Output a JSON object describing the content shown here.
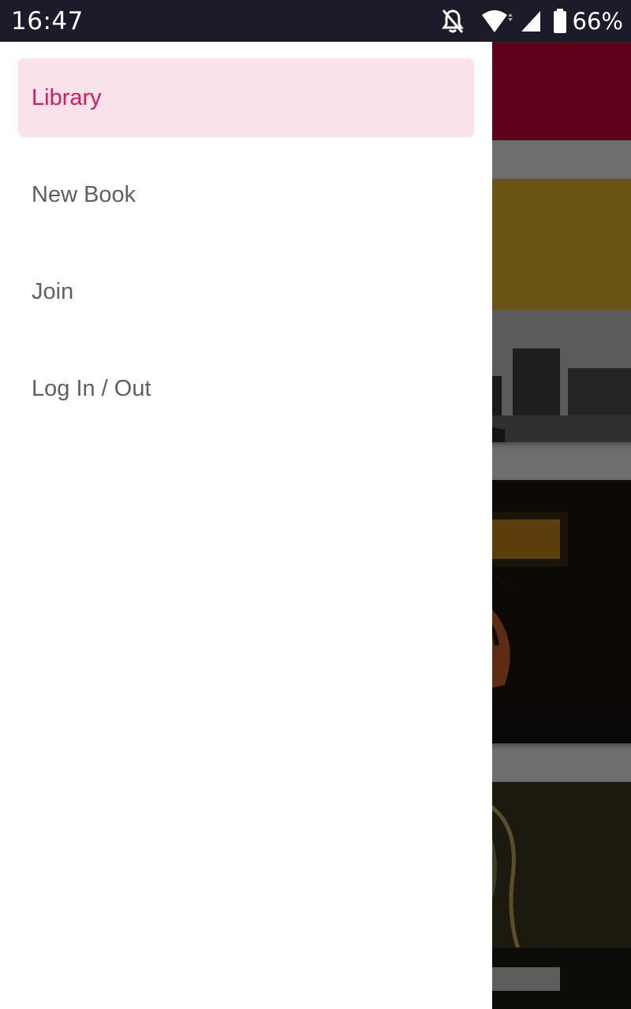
{
  "status_bar": {
    "time": "16:47",
    "battery_percent": "66%",
    "battery_level": 0.66,
    "icons": [
      "notifications-off-icon",
      "wifi-icon",
      "signal-icon",
      "battery-icon"
    ]
  },
  "drawer": {
    "items": [
      {
        "label": "Library",
        "active": true
      },
      {
        "label": "New Book",
        "active": false
      },
      {
        "label": "Join",
        "active": false
      },
      {
        "label": "Log In / Out",
        "active": false
      }
    ]
  },
  "colors": {
    "status_bar": "#1b1b29",
    "app_bar": "#d1063f",
    "accent": "#d81b60",
    "active_item_bg": "#f9e2ea",
    "drawer_text": "#5f5f63"
  }
}
